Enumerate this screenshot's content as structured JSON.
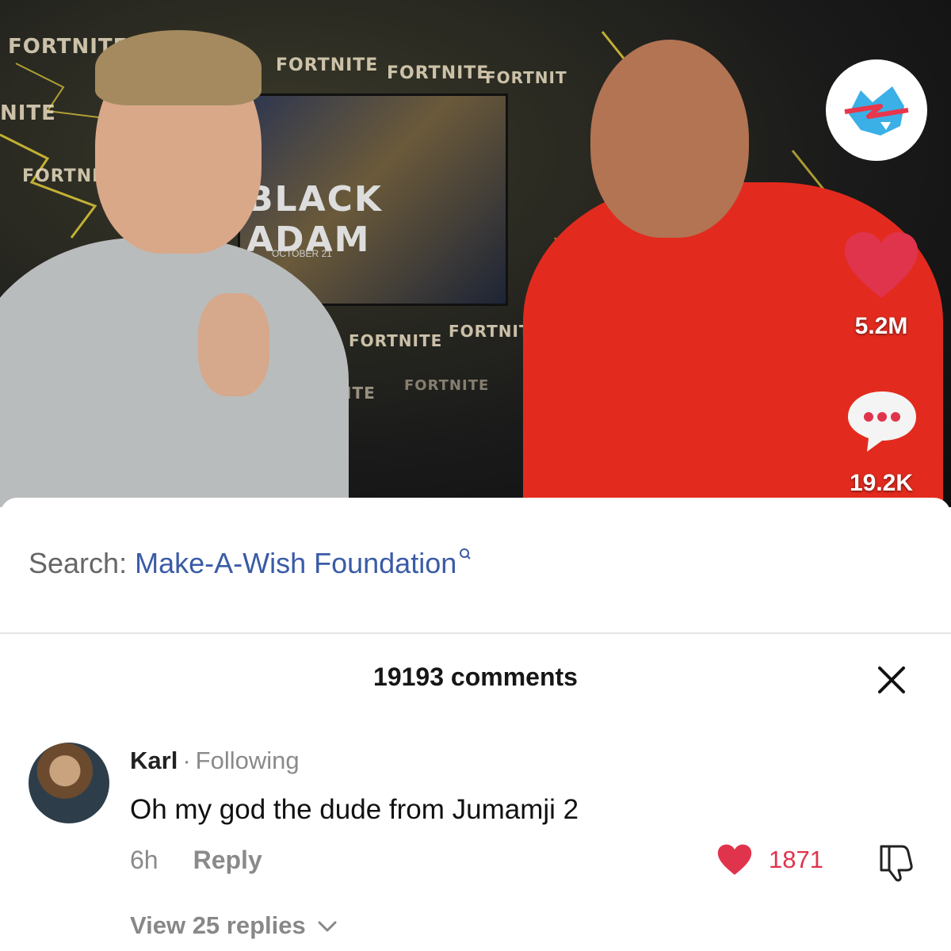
{
  "video": {
    "backdrop_words": [
      "FORTNITE",
      "FORTNITE",
      "FORTNITE",
      "FORTNIT",
      "NITE",
      "FORTNITE",
      "FORTNITE",
      "FORTNITE",
      "ITE",
      "FORTNITE"
    ],
    "screen_title": "BLACK ADAM",
    "screen_caption": "OCTOBER 21",
    "likes": "5.2M",
    "comments": "19.2K"
  },
  "search": {
    "prefix": "Search: ",
    "term": "Make-A-Wish Foundation"
  },
  "comments_panel": {
    "title": "19193 comments",
    "comment": {
      "author": "Karl",
      "separator": "·",
      "relation": "Following",
      "text": "Oh my god the dude from Jumamji 2",
      "age": "6h",
      "reply_label": "Reply",
      "like_count": "1871",
      "view_replies": "View 25 replies"
    }
  },
  "colors": {
    "accent_red": "#e0344d",
    "link_blue": "#3a5ba6"
  }
}
